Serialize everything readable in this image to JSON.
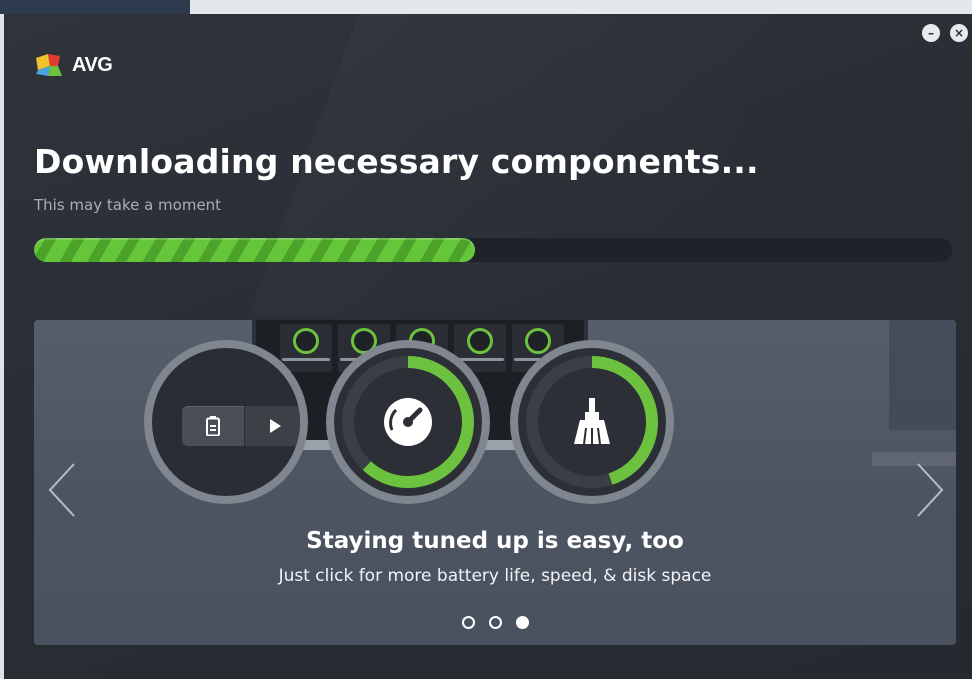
{
  "app": {
    "name": "AVG",
    "window_controls": {
      "minimize": "–",
      "close": "×"
    }
  },
  "status": {
    "title": "Downloading necessary components...",
    "subtitle": "This may take a moment",
    "progress_fraction": 0.48
  },
  "carousel": {
    "slide_title": "Staying tuned up is easy, too",
    "slide_subtitle": "Just click for more battery life, speed, & disk space",
    "features": [
      {
        "icon": "battery-icon",
        "secondary_icon": "play-icon"
      },
      {
        "icon": "speedometer-icon",
        "level": 0.62
      },
      {
        "icon": "broom-icon",
        "level": 0.45
      }
    ],
    "dots": 3,
    "active_dot": 2
  },
  "colors": {
    "accent_green": "#66c63a",
    "background": "#2a2e35",
    "carousel_bg": "#4a5260"
  }
}
